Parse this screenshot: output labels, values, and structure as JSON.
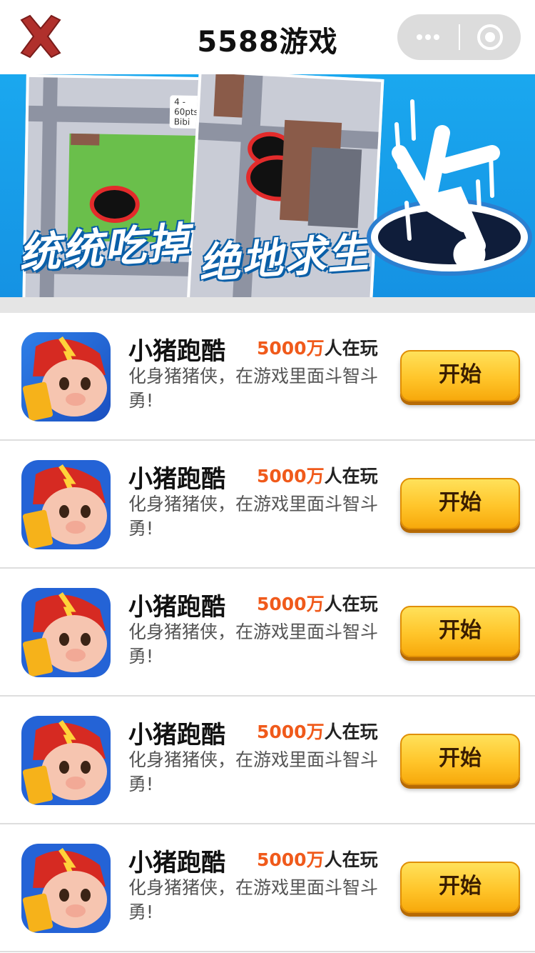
{
  "header": {
    "title": "5588游戏",
    "close_icon": "close-x-icon",
    "more_icon": "more-dots-icon",
    "exit_icon": "target-circle-icon"
  },
  "banner": {
    "slogan_left": "统统吃掉",
    "slogan_right": "绝地求生",
    "tag": "4 - 60pts Bibi"
  },
  "games": [
    {
      "name": "小猪跑酷",
      "players_number": "5000万",
      "players_suffix": "人在玩",
      "description": "化身猪猪侠，在游戏里面斗智斗勇!",
      "button": "开始"
    },
    {
      "name": "小猪跑酷",
      "players_number": "5000万",
      "players_suffix": "人在玩",
      "description": "化身猪猪侠，在游戏里面斗智斗勇!",
      "button": "开始"
    },
    {
      "name": "小猪跑酷",
      "players_number": "5000万",
      "players_suffix": "人在玩",
      "description": "化身猪猪侠，在游戏里面斗智斗勇!",
      "button": "开始"
    },
    {
      "name": "小猪跑酷",
      "players_number": "5000万",
      "players_suffix": "人在玩",
      "description": "化身猪猪侠，在游戏里面斗智斗勇!",
      "button": "开始"
    },
    {
      "name": "小猪跑酷",
      "players_number": "5000万",
      "players_suffix": "人在玩",
      "description": "化身猪猪侠，在游戏里面斗智斗勇!",
      "button": "开始"
    }
  ],
  "colors": {
    "accent_orange": "#f05a1b",
    "button_yellow": "#ffc52a",
    "banner_blue": "#1aa8ef",
    "close_red": "#b0302c"
  }
}
